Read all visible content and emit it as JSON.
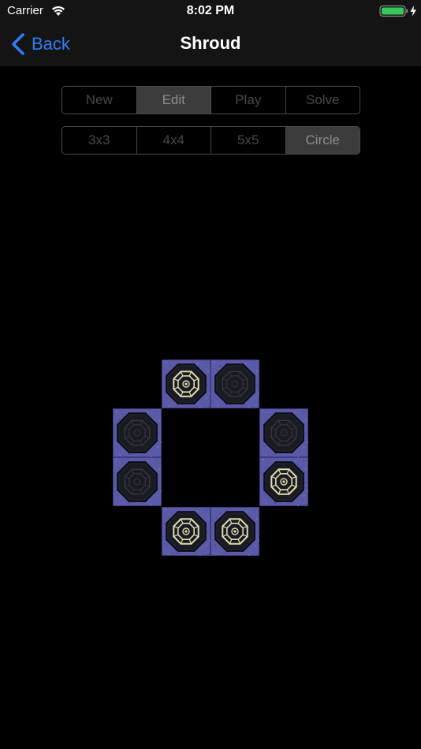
{
  "status_bar": {
    "carrier": "Carrier",
    "time": "8:02 PM",
    "battery_color": "#34c759"
  },
  "nav": {
    "back_label": "Back",
    "title": "Shroud",
    "accent_color": "#2f7cf6"
  },
  "mode_control": {
    "segments": [
      "New",
      "Edit",
      "Play",
      "Solve"
    ],
    "selected": "Edit"
  },
  "size_control": {
    "segments": [
      "3x3",
      "4x4",
      "5x5",
      "Circle"
    ],
    "selected": "Circle"
  },
  "board": {
    "layout": "circle",
    "tile_color": "#5a5aa8",
    "tiles": [
      {
        "id": "top-left",
        "lit": true
      },
      {
        "id": "top-right",
        "lit": false
      },
      {
        "id": "left-upper",
        "lit": false
      },
      {
        "id": "right-upper",
        "lit": false
      },
      {
        "id": "left-lower",
        "lit": false
      },
      {
        "id": "right-lower",
        "lit": true
      },
      {
        "id": "bottom-left",
        "lit": true
      },
      {
        "id": "bottom-right",
        "lit": true
      }
    ]
  }
}
